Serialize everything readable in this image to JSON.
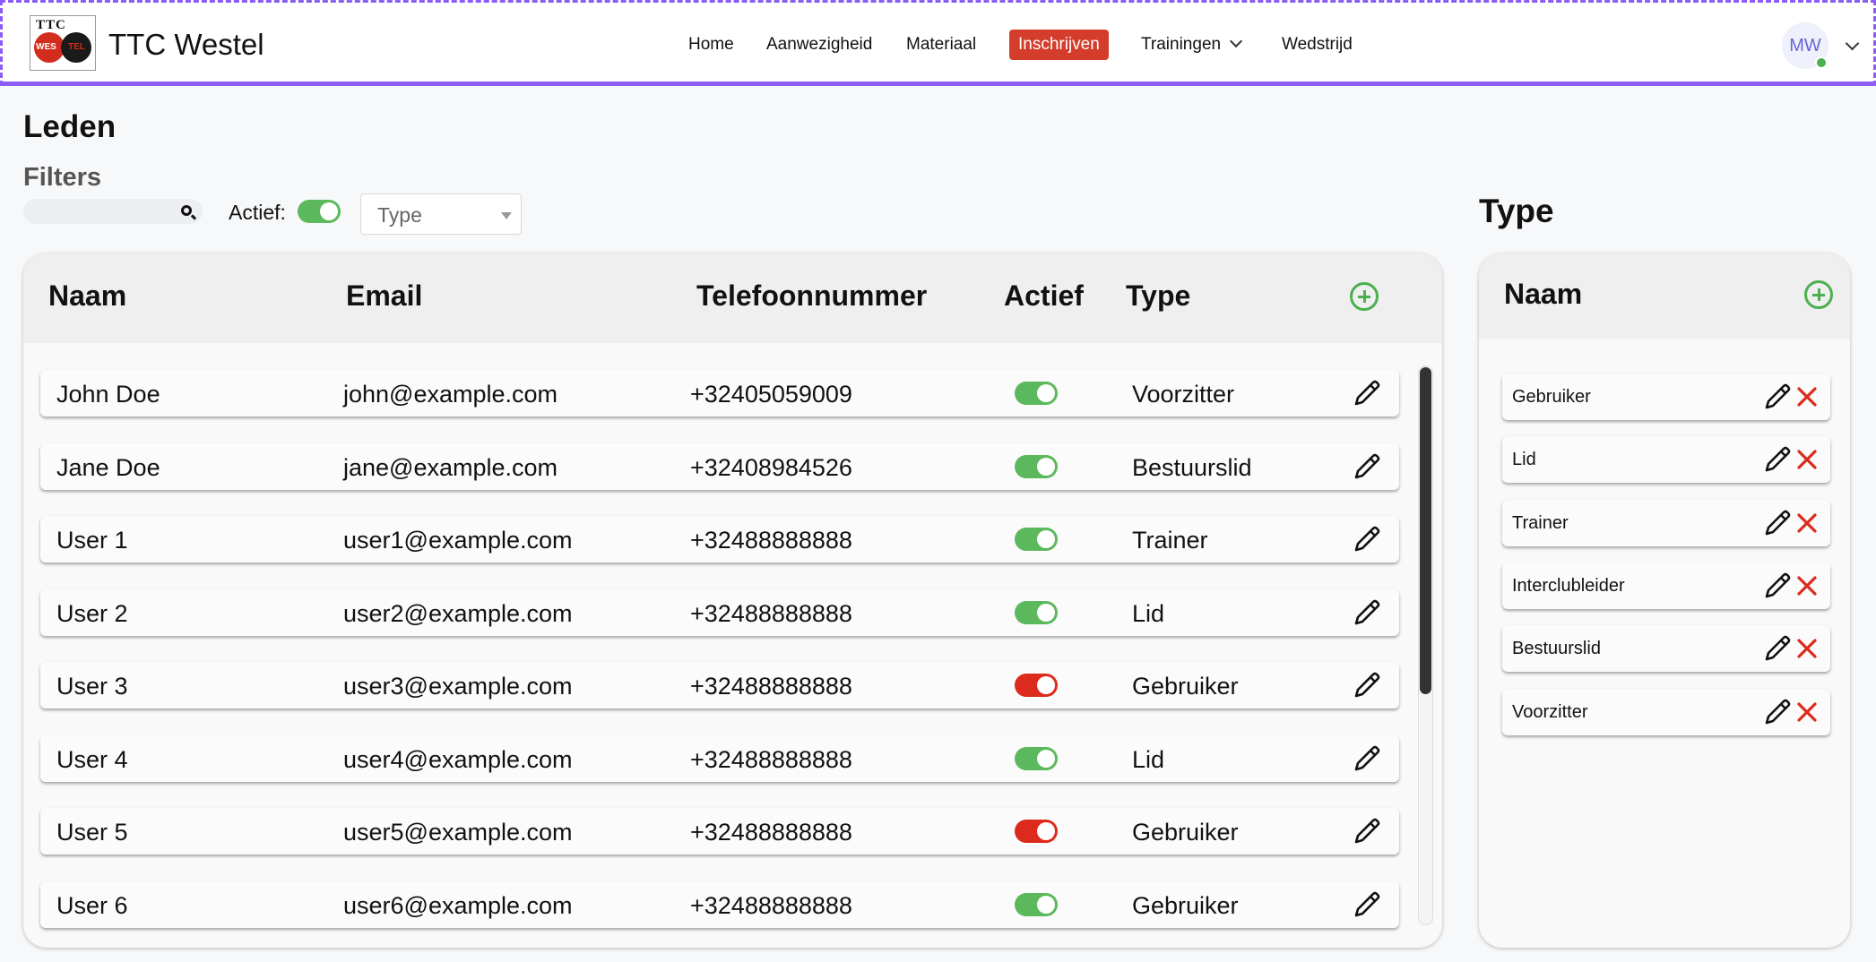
{
  "brand": {
    "name": "TTC Westel",
    "logo_top": "TTC",
    "logo_left": "WES",
    "logo_right": "TEL"
  },
  "nav": {
    "home": "Home",
    "aanwezigheid": "Aanwezigheid",
    "materiaal": "Materiaal",
    "inschrijven": "Inschrijven",
    "trainingen": "Trainingen",
    "wedstrijd": "Wedstrijd"
  },
  "user": {
    "initials": "MW"
  },
  "page": {
    "title": "Leden",
    "filters_title": "Filters",
    "actief_label": "Actief:",
    "type_placeholder": "Type"
  },
  "members_table": {
    "headers": {
      "naam": "Naam",
      "email": "Email",
      "telefoon": "Telefoonnummer",
      "actief": "Actief",
      "type": "Type"
    },
    "rows": [
      {
        "naam": "John Doe",
        "email": "john@example.com",
        "telefoon": "+32405059009",
        "actief": true,
        "type": "Voorzitter"
      },
      {
        "naam": "Jane Doe",
        "email": "jane@example.com",
        "telefoon": "+32408984526",
        "actief": true,
        "type": "Bestuurslid"
      },
      {
        "naam": "User 1",
        "email": "user1@example.com",
        "telefoon": "+32488888888",
        "actief": true,
        "type": "Trainer"
      },
      {
        "naam": "User 2",
        "email": "user2@example.com",
        "telefoon": "+32488888888",
        "actief": true,
        "type": "Lid"
      },
      {
        "naam": "User 3",
        "email": "user3@example.com",
        "telefoon": "+32488888888",
        "actief": false,
        "type": "Gebruiker"
      },
      {
        "naam": "User 4",
        "email": "user4@example.com",
        "telefoon": "+32488888888",
        "actief": true,
        "type": "Lid"
      },
      {
        "naam": "User 5",
        "email": "user5@example.com",
        "telefoon": "+32488888888",
        "actief": false,
        "type": "Gebruiker"
      },
      {
        "naam": "User 6",
        "email": "user6@example.com",
        "telefoon": "+32488888888",
        "actief": true,
        "type": "Gebruiker"
      }
    ]
  },
  "type_panel": {
    "title": "Type",
    "header": "Naam",
    "items": [
      "Gebruiker",
      "Lid",
      "Trainer",
      "Interclubleider",
      "Bestuurslid",
      "Voorzitter"
    ]
  },
  "colors": {
    "accent": "#8b5cf6",
    "active_nav": "#d43c2b",
    "toggle_on": "#5cb85c",
    "toggle_off": "#dc2a1c",
    "add": "#4caf50",
    "delete": "#dc2a1c"
  }
}
